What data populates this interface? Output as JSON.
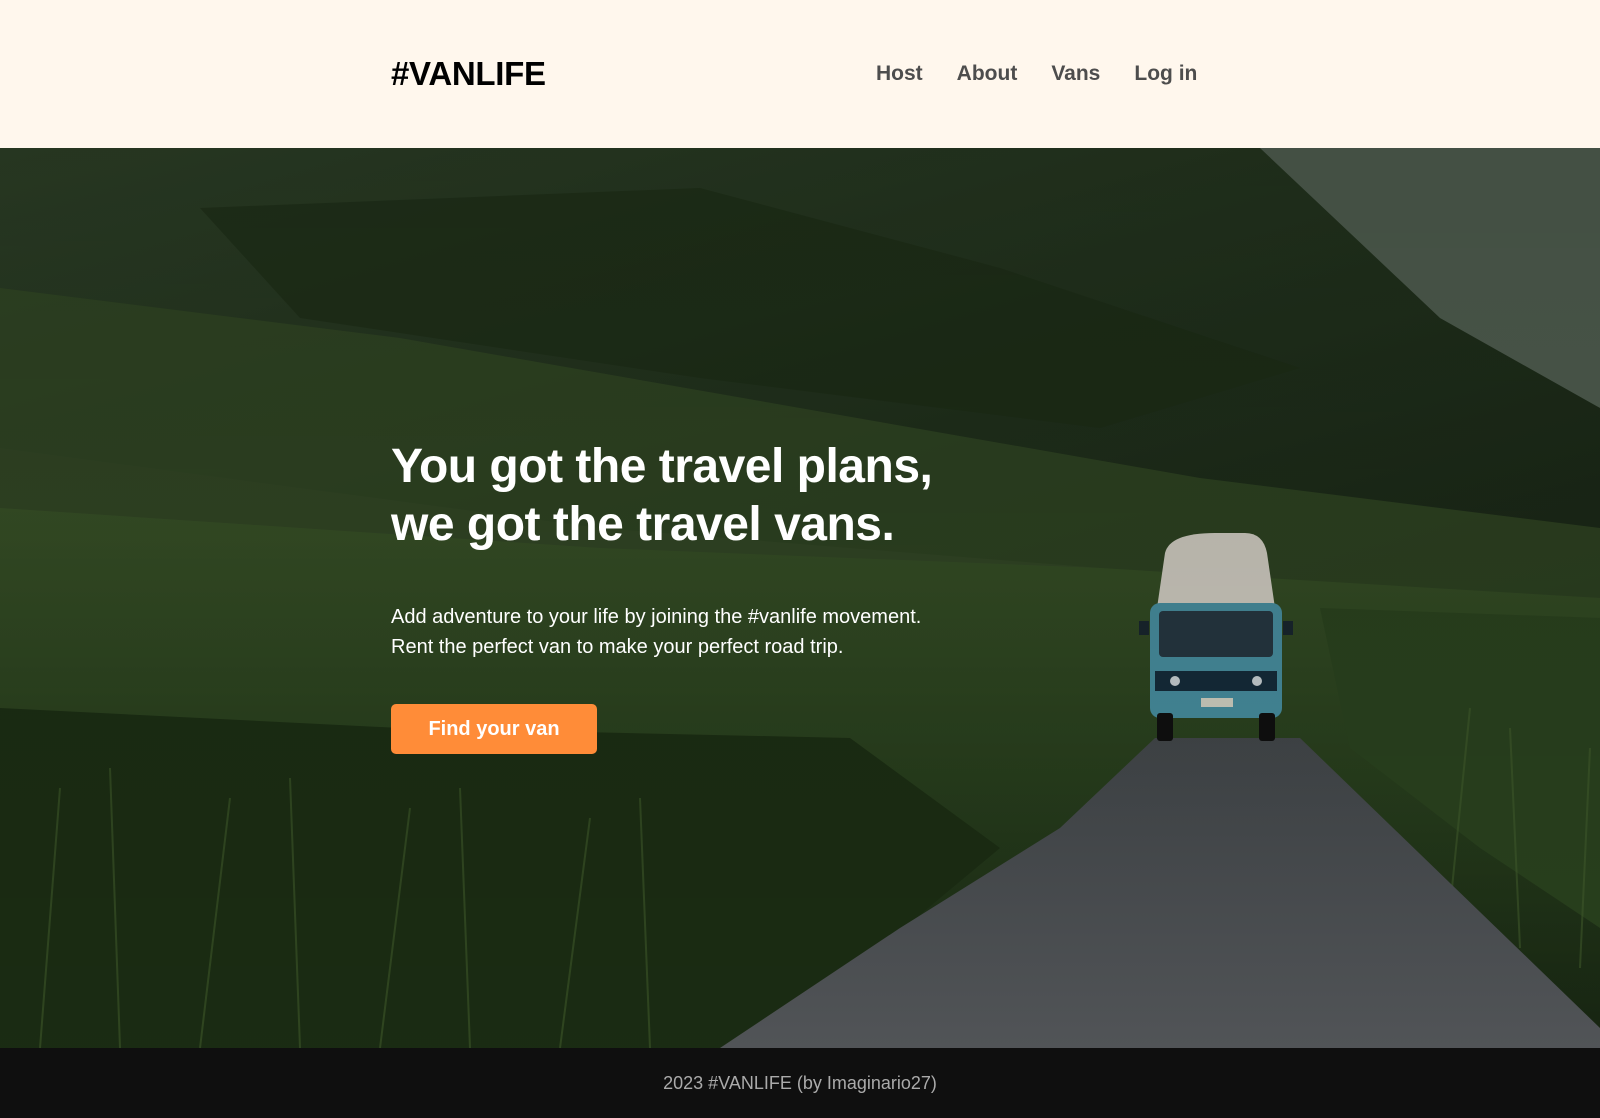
{
  "header": {
    "logo": "#VANLIFE",
    "nav": [
      {
        "label": "Host"
      },
      {
        "label": "About"
      },
      {
        "label": "Vans"
      },
      {
        "label": "Log in"
      }
    ]
  },
  "hero": {
    "title_line1": "You got the travel plans,",
    "title_line2": "we got the travel vans.",
    "subtitle_line1": "Add adventure to your life by joining the #vanlife movement.",
    "subtitle_line2": "Rent the perfect van to make your perfect road trip.",
    "cta_label": "Find your van",
    "background_image": "mountain-valley-road-with-camper-van"
  },
  "footer": {
    "text": "2023 #VANLIFE (by Imaginario27)"
  },
  "colors": {
    "header_bg": "#fff7ed",
    "cta_bg": "#ff8c38",
    "footer_bg": "#0f0f0f",
    "nav_text": "#4d4d4d"
  }
}
